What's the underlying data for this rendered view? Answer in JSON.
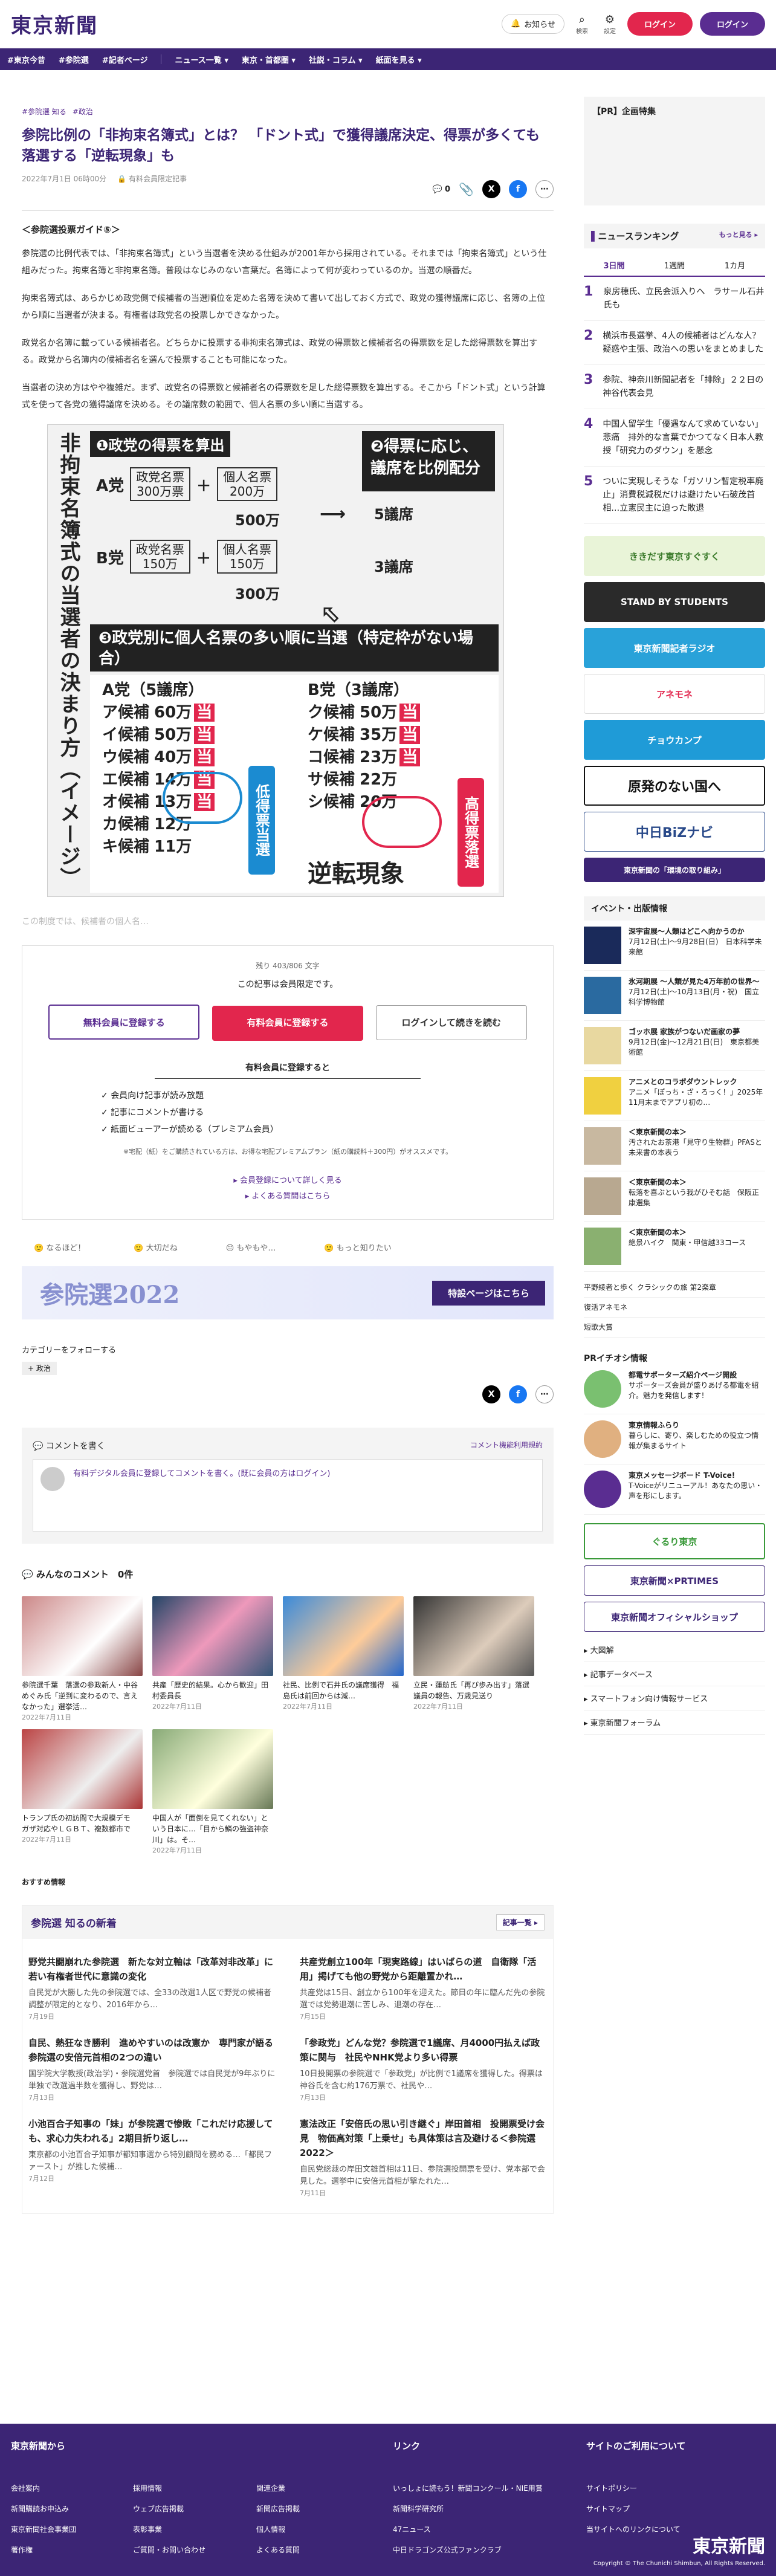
{
  "header": {
    "logo": "東京新聞",
    "notify": "お知らせ",
    "search": "検索",
    "settings": "設定",
    "login": "ログイン",
    "logout": "ログイン"
  },
  "nav": [
    "#東京今昔",
    "#参院選",
    "#記者ページ",
    "ニュース一覧 ▾",
    "東京・首都圏 ▾",
    "社説・コラム ▾",
    "紙面を見る ▾"
  ],
  "article": {
    "crumbs": [
      "#参院選 知る",
      "#政治"
    ],
    "title": "参院比例の「非拘束名簿式」とは？ 「ドント式」で獲得議席決定、得票が多くても落選する「逆転現象」も",
    "date": "2022年7月1日 06時00分",
    "badge": "有料会員限定記事",
    "comment_count": "0",
    "guide": "＜参院選投票ガイド⑤＞",
    "paras": [
      "参院選の比例代表では、「非拘束名簿式」という当選者を決める仕組みが2001年から採用されている。それまでは「拘束名簿式」という仕組みだった。拘束名簿と非拘束名簿。普段はなじみのない言葉だ。名簿によって何が変わっているのか。当選の順番だ。",
      "拘束名簿式は、あらかじめ政党側で候補者の当選順位を定めた名簿を決めて書いて出しておく方式で、政党の獲得議席に応じ、名簿の上位から順に当選者が決まる。有権者は政党名の投票しかできなかった。",
      "政党名か名簿に載っている候補者名。どちらかに投票する非拘束名簿式は、政党の得票数と候補者名の得票数を足した総得票数を算出する。政党から名簿内の候補者名を選んで投票することも可能になった。",
      "当選者の決め方はやや複雑だ。まず、政党名の得票数と候補者名の得票数を足した総得票数を算出する。そこから「ドント式」という計算式を使って各党の獲得議席を決める。その議席数の範囲で、個人名票の多い順に当選する。"
    ],
    "fade": "この制度では、候補者の個人名…",
    "remaining": "残り 403/806 文字",
    "member_only": "この記事は会員限定です。",
    "btn_free": "無料会員に登録する",
    "btn_paid": "有料会員に登録する",
    "btn_login": "ログインして続きを読む",
    "benefit_title": "有料会員に登録すると",
    "benefits": [
      "会員向け記事が読み放題",
      "記事にコメントが書ける",
      "紙面ビューアーが読める（プレミアム会員）"
    ],
    "note": "※宅配（紙）をご購読されている方は、お得な宅配プレミアムプラン（紙の購読料＋300円）がオススメです。",
    "link1": "▸ 会員登録について詳しく見る",
    "link2": "▸ よくある質問はこちら",
    "reactions": [
      "なるほど！",
      "大切だね",
      "もやもや…",
      "もっと知りたい"
    ],
    "banner": "参院選2022",
    "banner_btn": "特設ページはこちら",
    "follow": "カテゴリーをフォローする",
    "follow_tag": "政治"
  },
  "infographic": {
    "vtitle": "非拘束名簿式の当選者の決まり方（イメージ）",
    "s1": "❶政党の得票を算出",
    "s2": "❷得票に応じ、議席を比例配分",
    "partyA": "A党",
    "partyB": "B党",
    "party_votes_label": "政党名票",
    "personal_votes_label": "個人名票",
    "a_party": "300万票",
    "a_personal": "200万",
    "b_party": "150万",
    "b_personal": "150万",
    "a_total": "500万",
    "b_total": "300万",
    "a_seats": "5議席",
    "b_seats": "3議席",
    "s3": "❸政党別に個人名票の多い順に当選（特定枠がない場合）",
    "a_head": "A党（5議席）",
    "b_head": "B党（3議席）",
    "a_rows": [
      [
        "ア候補",
        "60万",
        "当"
      ],
      [
        "イ候補",
        "50万",
        "当"
      ],
      [
        "ウ候補",
        "40万",
        "当"
      ],
      [
        "エ候補",
        "14万",
        "当"
      ],
      [
        "オ候補",
        "13万",
        "当"
      ],
      [
        "カ候補",
        "12万",
        ""
      ],
      [
        "キ候補",
        "11万",
        ""
      ]
    ],
    "b_rows": [
      [
        "ク候補",
        "50万",
        "当"
      ],
      [
        "ケ候補",
        "35万",
        "当"
      ],
      [
        "コ候補",
        "23万",
        "当"
      ],
      [
        "サ候補",
        "22万",
        ""
      ],
      [
        "シ候補",
        "20万",
        ""
      ]
    ],
    "low": "低得票当選",
    "high": "高得票落選",
    "reverse": "逆転現象"
  },
  "comments": {
    "title": "コメントを書く",
    "policy": "コメント機能利用規約",
    "prompt": "有料デジタル会員に登録してコメントを書く。(既に会員の方はログイン)",
    "list_title": "みんなのコメント　0件"
  },
  "news": [
    {
      "cap": "参院選千葉　落選の参政新人・中谷めぐみ氏「逆到に変わるので、言えなかった」選挙活…",
      "date": "2022年7月11日"
    },
    {
      "cap": "共産「歴史的結果。心から歓迎」田村委員長",
      "date": "2022年7月11日"
    },
    {
      "cap": "社民、比例で石井氏の議席獲得　福島氏は前回からは減…",
      "date": "2022年7月11日"
    },
    {
      "cap": "立民・蓮舫氏「再び歩み出す」落選議員の報告、万歳見送り",
      "date": "2022年7月11日"
    },
    {
      "cap": "トランプ氏の初訪問で大規模デモ　ガザ対応やＬＧＢＴ、複数都市で",
      "date": "2022年7月11日"
    },
    {
      "cap": "中国人が「面倒を見てくれない」という日本に…「目から鱗の強盗神奈川」は。そ…",
      "date": "2022年7月11日"
    }
  ],
  "recommend": "おすすめ情報",
  "latest": {
    "title": "参院選 知るの新着",
    "more": "記事一覧 ▸",
    "items": [
      {
        "t": "野党共闘崩れた参院選　新たな対立軸は「改革対非改革」に　若い有権者世代に意識の変化",
        "d": "自民党が大勝した先の参院選では、全33の改選1人区で野党の候補者調整が限定的となり、2016年から…",
        "date": "7月19日"
      },
      {
        "t": "共産党創立100年「現実路線」はいばらの道　自衛隊「活用」掲げても他の野党から距離置かれ…",
        "d": "共産党は15日、創立から100年を迎えた。節目の年に臨んだ先の参院選では党勢退潮に苦しみ、退潮の存在…",
        "date": "7月15日"
      },
      {
        "t": "自民、熱狂なき勝利　進めやすいのは改憲か　専門家が語る参院選の安倍元首相の2つの違い",
        "d": "国学院大学教授(政治学)・参院選党首　参院選では自民党が9年ぶりに単独で改選過半数を獲得し、野党は…",
        "date": "7月13日"
      },
      {
        "t": "「参政党」どんな党？参院選で1議席、月4000円払えば政策に関与　社民やNHK党より多い得票",
        "d": "10日投開票の参院選で「参政党」が比例で1議席を獲得した。得票は神谷氏を含む約176万票で、社民や…",
        "date": "7月13日"
      },
      {
        "t": "小池百合子知事の「妹」が参院選で惨敗「これだけ応援しても、求心力失われる」2期目折り返し…",
        "d": "東京都の小池百合子知事が都知事選から特別顧問を務める…「都民ファースト」が推した候補…",
        "date": "7月12日"
      },
      {
        "t": "憲法改正「安倍氏の思い引き継ぐ」岸田首相　投開票受け会見　物価高対策「上乗せ」も具体策は言及避ける＜参院選2022＞",
        "d": "自民党総裁の岸田文雄首相は11日、参院選投開票を受け、党本部で会見した。選挙中に安倍元首相が撃たれた…",
        "date": "7月11日"
      }
    ]
  },
  "sidebar": {
    "pr": "【PR】企画特集",
    "ranking_title": "ニュースランキング",
    "ranking_more": "もっと見る ▸",
    "tabs": [
      "3日間",
      "1週間",
      "1カ月"
    ],
    "ranks": [
      {
        "n": "1",
        "t": "泉房穂氏、立民会派入りへ　ラサール石井氏も"
      },
      {
        "n": "2",
        "t": "横浜市長選挙、4人の候補者はどんな人？疑惑や主張、政治への思いをまとめました"
      },
      {
        "n": "3",
        "t": "参院、神奈川新聞記者を「排除」２２日の神谷代表会見"
      },
      {
        "n": "4",
        "t": "中国人留学生「優遇なんて求めていない」悲痛　排外的な言葉でかつてなく日本人教授「研究力のダウン」を懸念"
      },
      {
        "n": "5",
        "t": "ついに実現しそうな「ガソリン暫定税率廃止」消費税減税だけは避けたい石破茂首相…立憲民主に迫った敗退"
      }
    ],
    "ads": [
      "ききだす東京すぐすく",
      "STAND BY STUDENTS",
      "東京新聞記者ラジオ",
      "アネモネ",
      "チョウカンプ",
      "原発のない国へ",
      "中日BiZナビ",
      "東京新聞の「環境の取り組み」"
    ],
    "events_title": "イベント・出版情報",
    "events": [
      {
        "t": "深宇宙展〜人類はどこへ向かうのか",
        "d": "7月12日(土)〜9月28日(日)　日本科学未来館"
      },
      {
        "t": "氷河期展 〜人類が見た4万年前の世界〜",
        "d": "7月12日(土)〜10月13日(月・祝)　国立科学博物館"
      },
      {
        "t": "ゴッホ展 家族がつないだ画家の夢",
        "d": "9月12日(金)〜12月21日(日)　東京都美術館"
      },
      {
        "t": "アニメとのコラボダウントレック",
        "d": "アニメ「ぽっち・ざ・ろっく！」2025年11月末までアプリ初の…"
      },
      {
        "t": "＜東京新聞の本＞",
        "d": "汚されたお茶港「見守り生物群」PFASと未来書の本表う"
      },
      {
        "t": "＜東京新聞の本＞",
        "d": "転落を喜ぶという我がひそむ話　保阪正康選集"
      },
      {
        "t": "＜東京新聞の本＞",
        "d": "絶景ハイク　関東・甲信越33コース"
      }
    ],
    "mini_links": [
      "平野綾者と歩く クラシックの旅 第2楽章",
      "復活アネモネ",
      "短歌大賞"
    ],
    "pr2_title": "PRイチオシ情報",
    "pr2": [
      {
        "t": "都電サポーターズ紹介ページ開設",
        "d": "サポーターズ会員が盛りあげる都電を紹介。魅力を発信します！"
      },
      {
        "t": "東京情報ふらり",
        "d": "暮らしに、寄り、楽しむための役立つ情報が集まるサイト"
      },
      {
        "t": "東京メッセージボード T-Voice!",
        "d": "T-Voiceがリニューアル！あなたの思い・声を形にします。"
      }
    ],
    "banners": [
      "ぐるり東京",
      "東京新聞×PRTIMES",
      "東京新聞オフィシャルショップ"
    ],
    "links": [
      "大図解",
      "記事データベース",
      "スマートフォン向け情報サービス",
      "東京新聞フォーラム"
    ]
  },
  "footer": {
    "from": "東京新聞から",
    "link": "リンク",
    "terms": "サイトのご利用について",
    "col1": [
      "会社案内",
      "新聞購読お申込み",
      "東京新聞社会事業団",
      "著作権"
    ],
    "col2": [
      "採用情報",
      "ウェブ広告掲載",
      "表彰事業",
      "ご質問・お問い合わせ"
    ],
    "col3": [
      "関連企業",
      "新聞広告掲載",
      "個人情報",
      "よくある質問"
    ],
    "col4": [
      "いっしょに読もう！新聞コンクール・NIE用賞",
      "新聞科学研究所",
      "47ニュース",
      "中日ドラゴンズ公式ファンクラブ"
    ],
    "col5": [
      "サイトポリシー",
      "サイトマップ",
      "当サイトへのリンクについて"
    ],
    "logo": "東京新聞",
    "copyright": "Copyright © The Chunichi Shimbun, All Rights Reserved."
  },
  "colors": {
    "brand": "#3c2575",
    "accent": "#e2264d"
  }
}
